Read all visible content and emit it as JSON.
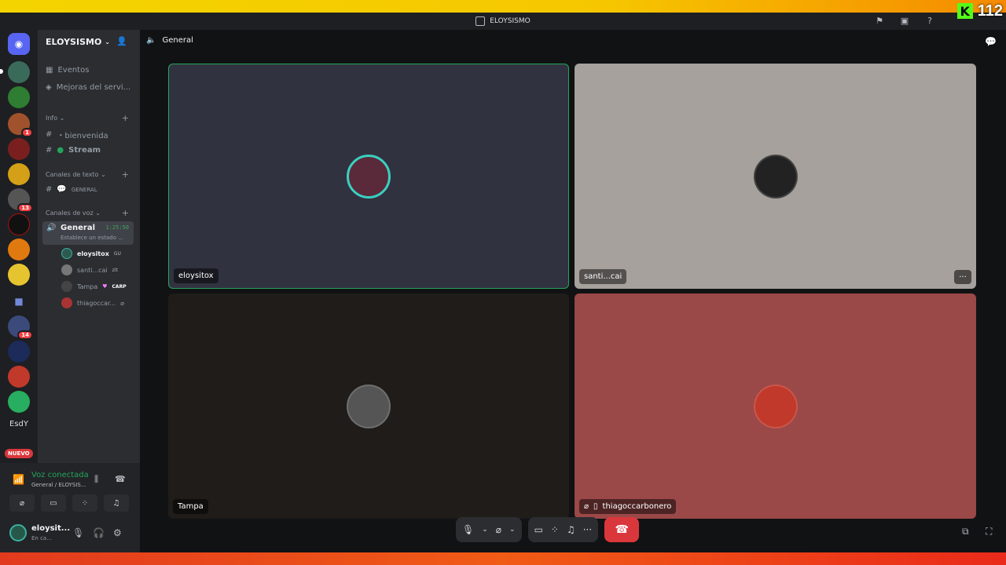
{
  "window": {
    "title": "ELOYSISMO"
  },
  "overlay": {
    "viewer_count": "112"
  },
  "server_list": {
    "badges": [
      "1",
      "13",
      "14"
    ],
    "esdy_label": "EsdY",
    "nuevo_label": "NUEVO"
  },
  "guild": {
    "name": "ELOYSISMO",
    "top_items": [
      {
        "label": "Eventos"
      },
      {
        "label": "Mejoras del servi..."
      }
    ],
    "categories": [
      {
        "label": "Info"
      },
      {
        "label": "Canales de texto"
      },
      {
        "label": "Canales de voz"
      }
    ],
    "info_channels": [
      {
        "label": "・bienvenida"
      },
      {
        "label": "Stream"
      }
    ],
    "text_channels": [
      {
        "label": "GENERAL"
      }
    ],
    "voice_channel": {
      "name": "General",
      "timer": "1:25:50",
      "status": "Establece un estado ..."
    },
    "voice_users": [
      {
        "name": "eloysitox",
        "tag": "GU",
        "color": "#2d5a4f"
      },
      {
        "name": "santi...cai",
        "tag": "zit",
        "color": "#777"
      },
      {
        "name": "Tampa",
        "tag": "CARP",
        "color": "#444"
      },
      {
        "name": "thiagoccar...",
        "tag": "",
        "color": "#a33"
      }
    ]
  },
  "voice_bar": {
    "status": "Voz conectada",
    "channel": "General / ELOYSIS..."
  },
  "user_bar": {
    "username": "eloysit...",
    "status": "En ca..."
  },
  "main": {
    "channel_name": "General",
    "tiles": [
      {
        "name": "eloysitox",
        "bg": "#313240",
        "avatar_color": "#5a2a3a",
        "speaking": true
      },
      {
        "name": "santi...cai",
        "bg": "#a6a19c",
        "avatar_color": "#222",
        "speaking": false
      },
      {
        "name": "Tampa",
        "bg": "#1f1c1a",
        "avatar_color": "#555",
        "speaking": false
      },
      {
        "name": "thiagoccarbonero",
        "bg": "#9b4848",
        "avatar_color": "#c0392b",
        "speaking": false
      }
    ]
  }
}
